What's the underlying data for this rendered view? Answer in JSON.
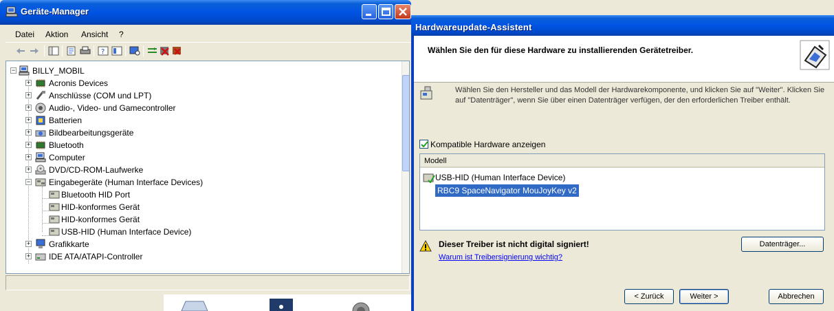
{
  "device_manager": {
    "title": "Geräte-Manager",
    "menu": [
      "Datei",
      "Aktion",
      "Ansicht",
      "?"
    ],
    "tree": {
      "root": "BILLY_MOBIL",
      "items": [
        {
          "label": "Acronis Devices",
          "icon": "chip-icon"
        },
        {
          "label": "Anschlüsse (COM und LPT)",
          "icon": "port-icon"
        },
        {
          "label": "Audio-, Video- und Gamecontroller",
          "icon": "speaker-icon"
        },
        {
          "label": "Batterien",
          "icon": "battery-icon"
        },
        {
          "label": "Bildbearbeitungsgeräte",
          "icon": "camera-icon"
        },
        {
          "label": "Bluetooth",
          "icon": "chip-icon"
        },
        {
          "label": "Computer",
          "icon": "computer-icon"
        },
        {
          "label": "DVD/CD-ROM-Laufwerke",
          "icon": "cdrom-icon"
        },
        {
          "label": "Eingabegeräte (Human Interface Devices)",
          "icon": "hid-icon",
          "expanded": true,
          "children": [
            "Bluetooth HID Port",
            "HID-konformes Gerät",
            "HID-konformes Gerät",
            "USB-HID (Human Interface Device)"
          ]
        },
        {
          "label": "Grafikkarte",
          "icon": "display-icon"
        },
        {
          "label": "IDE ATA/ATAPI-Controller",
          "icon": "drive-icon"
        }
      ]
    }
  },
  "wizard": {
    "title": "Hardwareupdate-Assistent",
    "header": "Wählen Sie den für diese Hardware zu installierenden Gerätetreiber.",
    "info": "Wählen Sie den Hersteller und das Modell der Hardwarekomponente, und klicken Sie auf \"Weiter\". Klicken Sie auf \"Datenträger\", wenn Sie über einen Datenträger verfügen, der den erforderlichen Treiber enthält.",
    "show_compatible": {
      "label": "Kompatible Hardware anzeigen",
      "checked": true
    },
    "list": {
      "header": "Modell",
      "items": [
        {
          "label": "USB-HID (Human Interface Device)",
          "selected": false
        },
        {
          "label": "RBC9 SpaceNavigator MouJoyKey v2",
          "selected": true
        }
      ]
    },
    "warning": "Dieser Treiber ist nicht digital signiert!",
    "warning_link": "Warum ist Treibersignierung wichtig?",
    "buttons": {
      "disk": "Datenträger...",
      "back": "< Zurück",
      "next": "Weiter >",
      "cancel": "Abbrechen"
    }
  }
}
